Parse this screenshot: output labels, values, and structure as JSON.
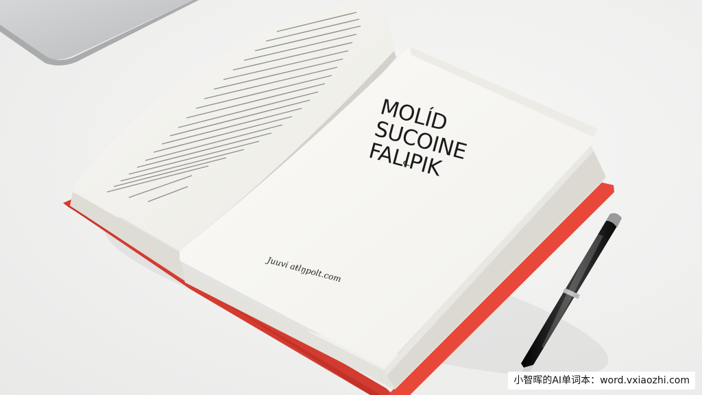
{
  "book": {
    "title_lines": [
      "MOLÍD",
      "SUCOINE",
      "FALIPIK"
    ],
    "title_mark": "ᓚ",
    "imprint": "Juuvi aŧlŋpolt.com",
    "cover_color": "#e8483a",
    "page_color": "#f6f5f1"
  },
  "watermark": {
    "text": "小智晖的AI单词本：word.vxiaozhi.com"
  },
  "colors": {
    "background": "#f2f2f1",
    "pen_body": "#111111",
    "laptop": "#c9cbcc"
  }
}
